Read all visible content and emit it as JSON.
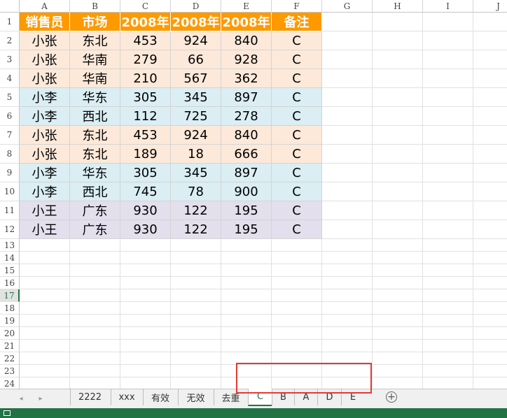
{
  "columns": [
    "A",
    "B",
    "C",
    "D",
    "E",
    "F",
    "G",
    "H",
    "I",
    "J"
  ],
  "rows": [
    "1",
    "2",
    "3",
    "4",
    "5",
    "6",
    "7",
    "8",
    "9",
    "10",
    "11",
    "12",
    "13",
    "14",
    "15",
    "16",
    "17",
    "18",
    "19",
    "20",
    "21",
    "22",
    "23",
    "24"
  ],
  "active_row": "17",
  "table": {
    "headers": [
      "销售员",
      "市场",
      "2008年",
      "2008年",
      "2008年",
      "备注"
    ],
    "rows": [
      {
        "cells": [
          "小张",
          "东北",
          "453",
          "924",
          "840",
          "C"
        ],
        "color": "orange"
      },
      {
        "cells": [
          "小张",
          "华南",
          "279",
          "66",
          "928",
          "C"
        ],
        "color": "orange"
      },
      {
        "cells": [
          "小张",
          "华南",
          "210",
          "567",
          "362",
          "C"
        ],
        "color": "orange"
      },
      {
        "cells": [
          "小李",
          "华东",
          "305",
          "345",
          "897",
          "C"
        ],
        "color": "blue"
      },
      {
        "cells": [
          "小李",
          "西北",
          "112",
          "725",
          "278",
          "C"
        ],
        "color": "blue"
      },
      {
        "cells": [
          "小张",
          "东北",
          "453",
          "924",
          "840",
          "C"
        ],
        "color": "orange"
      },
      {
        "cells": [
          "小张",
          "东北",
          "189",
          "18",
          "666",
          "C"
        ],
        "color": "orange"
      },
      {
        "cells": [
          "小李",
          "华东",
          "305",
          "345",
          "897",
          "C"
        ],
        "color": "blue"
      },
      {
        "cells": [
          "小李",
          "西北",
          "745",
          "78",
          "900",
          "C"
        ],
        "color": "blue"
      },
      {
        "cells": [
          "小王",
          "广东",
          "930",
          "122",
          "195",
          "C"
        ],
        "color": "purple"
      },
      {
        "cells": [
          "小王",
          "广东",
          "930",
          "122",
          "195",
          "C"
        ],
        "color": "purple"
      }
    ]
  },
  "colors": {
    "header": "#ff9900",
    "orange": "#fde9d9",
    "blue": "#daeef3",
    "purple": "#e4dfec",
    "accent": "#217346",
    "highlight": "#e53935"
  },
  "sheet_tabs": [
    {
      "label": "2222",
      "active": false
    },
    {
      "label": "xxx",
      "active": false
    },
    {
      "label": "有效",
      "active": false
    },
    {
      "label": "无效",
      "active": false
    },
    {
      "label": "去重",
      "active": false
    },
    {
      "label": "C",
      "active": true
    },
    {
      "label": "B",
      "active": false
    },
    {
      "label": "A",
      "active": false
    },
    {
      "label": "D",
      "active": false
    },
    {
      "label": "E",
      "active": false
    }
  ],
  "add_sheet_label": "+",
  "nav": {
    "prev": "◂",
    "next": "▸"
  }
}
